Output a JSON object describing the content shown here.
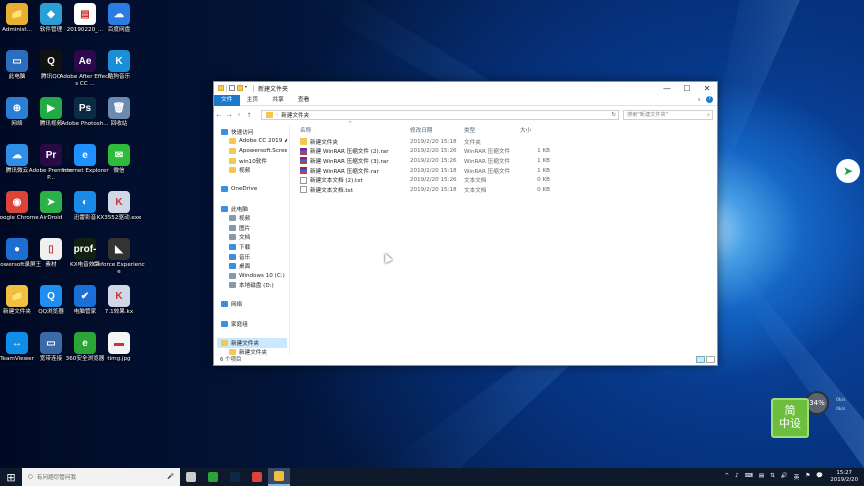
{
  "desktop": {
    "icons": [
      {
        "label": "Administ...",
        "icon": "folder-user-icon",
        "color": "#e8b030",
        "glyph": "📁"
      },
      {
        "label": "软件管理",
        "icon": "software-manager-icon",
        "color": "#2a9fd6",
        "glyph": "◆"
      },
      {
        "label": "2019022​0_...",
        "icon": "document-icon",
        "color": "#ffffff",
        "glyph": "▤"
      },
      {
        "label": "百度网盘",
        "icon": "baidu-netdisk-icon",
        "color": "#2c7be5",
        "glyph": "☁"
      },
      {
        "label": "此电脑",
        "icon": "this-pc-icon",
        "color": "#2a6ebd",
        "glyph": "▭"
      },
      {
        "label": "腾讯QQ",
        "icon": "qq-icon",
        "color": "#111111",
        "glyph": "Q"
      },
      {
        "label": "Adobe After Effects CC ...",
        "icon": "after-effects-icon",
        "color": "#2a0a4a",
        "glyph": "Ae"
      },
      {
        "label": "酷狗音乐",
        "icon": "kugou-icon",
        "color": "#1a8fd8",
        "glyph": "K"
      },
      {
        "label": "网络",
        "icon": "network-icon",
        "color": "#2a7fd4",
        "glyph": "⊕"
      },
      {
        "label": "腾讯视频",
        "icon": "tencent-video-icon",
        "color": "#22aa44",
        "glyph": "▶"
      },
      {
        "label": "Adobe Photosh...",
        "icon": "photoshop-icon",
        "color": "#0b2a44",
        "glyph": "Ps"
      },
      {
        "label": "回收站",
        "icon": "recycle-bin-icon",
        "color": "#6a8ab0",
        "glyph": "🗑"
      },
      {
        "label": "腾讯微云",
        "icon": "weiyun-icon",
        "color": "#2f8ee8",
        "glyph": "☁"
      },
      {
        "label": "Adobe Premiere P...",
        "icon": "premiere-icon",
        "color": "#2a0a44",
        "glyph": "Pr"
      },
      {
        "label": "Internet Explorer",
        "icon": "internet-explorer-icon",
        "color": "#1e90ff",
        "glyph": "e"
      },
      {
        "label": "微信",
        "icon": "wechat-icon",
        "color": "#2dbb3a",
        "glyph": "✉"
      },
      {
        "label": "Google Chrome",
        "icon": "chrome-icon",
        "color": "#db4437",
        "glyph": "◉"
      },
      {
        "label": "AirDroid",
        "icon": "airdroid-icon",
        "color": "#2bb04a",
        "glyph": "➤"
      },
      {
        "label": "迅雷影音",
        "icon": "xunlei-player-icon",
        "color": "#1a8ae8",
        "glyph": "◐"
      },
      {
        "label": "KX3552驱动.exe",
        "icon": "kx-driver-icon",
        "color": "#d0d8e8",
        "glyph": "K"
      },
      {
        "label": "Apowersoft录屏王",
        "icon": "apowersoft-icon",
        "color": "#1c6fd1",
        "glyph": "●"
      },
      {
        "label": "素材",
        "icon": "material-file-icon",
        "color": "#f0f0f0",
        "glyph": "▯"
      },
      {
        "label": "KX电音效果",
        "icon": "kx-effect-icon",
        "color": "#112211",
        "glyph": "prof-"
      },
      {
        "label": "Geforce Experience",
        "icon": "geforce-icon",
        "color": "#333333",
        "glyph": "◣"
      },
      {
        "label": "新建文件夹",
        "icon": "folder-icon",
        "color": "#f0c040",
        "glyph": "📁"
      },
      {
        "label": "QQ浏览器",
        "icon": "qq-browser-icon",
        "color": "#1f8ef1",
        "glyph": "Q"
      },
      {
        "label": "电脑管家",
        "icon": "pc-manager-icon",
        "color": "#1a6fd8",
        "glyph": "✔"
      },
      {
        "label": "7.1效果.kx",
        "icon": "kx-71-icon",
        "color": "#d0d8e8",
        "glyph": "K"
      },
      {
        "label": "TeamViewer",
        "icon": "teamviewer-icon",
        "color": "#0e8ee9",
        "glyph": "↔"
      },
      {
        "label": "宽带连接",
        "icon": "broadband-icon",
        "color": "#3a6aa8",
        "glyph": "▭"
      },
      {
        "label": "360安全浏览器",
        "icon": "360-browser-icon",
        "color": "#2aa536",
        "glyph": "e"
      },
      {
        "label": "timg.jpg",
        "icon": "image-file-icon",
        "color": "#f4f4f4",
        "glyph": "▬"
      }
    ]
  },
  "explorer": {
    "window_title": "新建文件夹",
    "controls": {
      "minimize": "—",
      "maximize": "☐",
      "close": "✕"
    },
    "ribbon": {
      "tabs": [
        "文件",
        "主页",
        "共享",
        "查看"
      ],
      "expand": "∨",
      "help": "?"
    },
    "address": {
      "back": "←",
      "forward": "→",
      "recent": "∨",
      "up": "↑",
      "path": "新建文件夹",
      "path_chevron": "›",
      "refresh": "↻"
    },
    "search": {
      "placeholder": "搜索\"新建文件夹\""
    },
    "nav": {
      "items": [
        {
          "label": "快速访问",
          "icon": "star-icon",
          "kind": "blu",
          "indent": 0
        },
        {
          "label": "Adobe CC 2019 ⬈",
          "icon": "folder-icon",
          "kind": "fld",
          "indent": 1
        },
        {
          "label": "Apowersoft.Scree",
          "icon": "folder-icon",
          "kind": "fld",
          "indent": 1
        },
        {
          "label": "win10软件",
          "icon": "folder-icon",
          "kind": "fld",
          "indent": 1
        },
        {
          "label": "视频",
          "icon": "folder-icon",
          "kind": "fld",
          "indent": 1
        },
        {
          "label": "",
          "icon": "",
          "kind": "",
          "indent": 0
        },
        {
          "label": "OneDrive",
          "icon": "onedrive-icon",
          "kind": "blu",
          "indent": 0
        },
        {
          "label": "",
          "icon": "",
          "kind": "",
          "indent": 0
        },
        {
          "label": "此电脑",
          "icon": "this-pc-icon",
          "kind": "blu",
          "indent": 0
        },
        {
          "label": "视频",
          "icon": "videos-icon",
          "kind": "gry",
          "indent": 1
        },
        {
          "label": "图片",
          "icon": "pictures-icon",
          "kind": "gry",
          "indent": 1
        },
        {
          "label": "文档",
          "icon": "documents-icon",
          "kind": "gry",
          "indent": 1
        },
        {
          "label": "下载",
          "icon": "downloads-icon",
          "kind": "blu",
          "indent": 1
        },
        {
          "label": "音乐",
          "icon": "music-icon",
          "kind": "blu",
          "indent": 1
        },
        {
          "label": "桌面",
          "icon": "desktop-icon",
          "kind": "blu",
          "indent": 1
        },
        {
          "label": "Windows 10 (C:)",
          "icon": "drive-c-icon",
          "kind": "gry",
          "indent": 1
        },
        {
          "label": "本地磁盘 (D:)",
          "icon": "drive-d-icon",
          "kind": "gry",
          "indent": 1
        },
        {
          "label": "",
          "icon": "",
          "kind": "",
          "indent": 0
        },
        {
          "label": "网络",
          "icon": "network-icon",
          "kind": "blu",
          "indent": 0
        },
        {
          "label": "",
          "icon": "",
          "kind": "",
          "indent": 0
        },
        {
          "label": "家庭组",
          "icon": "homegroup-icon",
          "kind": "blu",
          "indent": 0
        },
        {
          "label": "",
          "icon": "",
          "kind": "",
          "indent": 0
        },
        {
          "label": "新建文件夹",
          "icon": "folder-icon",
          "kind": "fld",
          "indent": 0,
          "selected": true
        },
        {
          "label": "新建文件夹",
          "icon": "folder-icon",
          "kind": "fld",
          "indent": 1
        }
      ]
    },
    "columns": {
      "name": "名称",
      "modified": "修改日期",
      "type": "类型",
      "size": "大小",
      "sort_indicator": "^"
    },
    "files": [
      {
        "name": "新建文件夹",
        "modified": "2019/2/20 15:18",
        "type": "文件夹",
        "size": "",
        "kind": "fld",
        "icon": "folder-icon"
      },
      {
        "name": "新建 WinRAR 压缩文件 (2).rar",
        "modified": "2019/2/20 15:26",
        "type": "WinRAR 压缩文件",
        "size": "1 KB",
        "kind": "rar",
        "icon": "winrar-icon"
      },
      {
        "name": "新建 WinRAR 压缩文件 (3).rar",
        "modified": "2019/2/20 15:26",
        "type": "WinRAR 压缩文件",
        "size": "1 KB",
        "kind": "rar",
        "icon": "winrar-icon"
      },
      {
        "name": "新建 WinRAR 压缩文件.rar",
        "modified": "2019/2/20 15:18",
        "type": "WinRAR 压缩文件",
        "size": "1 KB",
        "kind": "rar",
        "icon": "winrar-icon"
      },
      {
        "name": "新建文本文档 (2).txt",
        "modified": "2019/2/20 15:26",
        "type": "文本文档",
        "size": "0 KB",
        "kind": "txt",
        "icon": "text-file-icon"
      },
      {
        "name": "新建文本文档.txt",
        "modified": "2019/2/20 15:18",
        "type": "文本文档",
        "size": "0 KB",
        "kind": "txt",
        "icon": "text-file-icon"
      }
    ],
    "status": "6 个项目"
  },
  "overlay": {
    "net_percent": "34%",
    "net_up": "0k/s",
    "net_down": "0k/s",
    "stamp": "简\n中设",
    "float_arrow": "➤"
  },
  "taskbar": {
    "start": "⊞",
    "search_placeholder": "有问题尽管问我",
    "search_icon": "○",
    "mic": "🎤",
    "apps": [
      {
        "icon": "task-view-icon",
        "color": "#cccccc",
        "active": false
      },
      {
        "icon": "360-browser-icon",
        "color": "#2aa536",
        "active": false
      },
      {
        "icon": "photoshop-icon",
        "color": "#0b2a44",
        "active": false
      },
      {
        "icon": "chrome-icon",
        "color": "#db4437",
        "active": false
      },
      {
        "icon": "file-explorer-icon",
        "color": "#f0c040",
        "active": true
      }
    ],
    "tray_icons": [
      "^",
      "♪",
      "⌨",
      "▤",
      "⇅",
      "🔊",
      "英",
      "⚑",
      "💬"
    ],
    "time": "15:27",
    "date": "2019/2/20"
  }
}
